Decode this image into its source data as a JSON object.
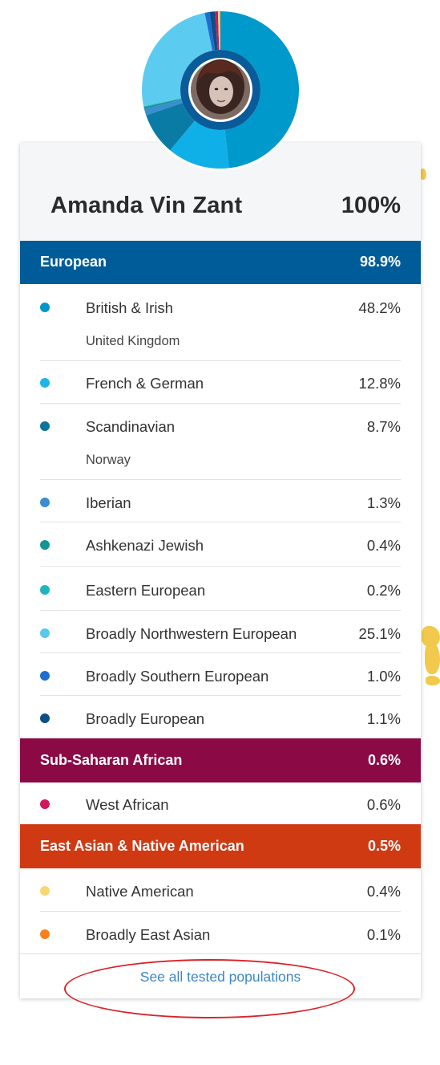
{
  "profile": {
    "name": "Amanda Vin Zant",
    "total": "100%"
  },
  "groups": [
    {
      "name": "European",
      "pct": "98.9%",
      "color": "#005c99"
    },
    {
      "name": "Sub-Saharan African",
      "pct": "0.6%",
      "color": "#8b0a45"
    },
    {
      "name": "East Asian & Native American",
      "pct": "0.5%",
      "color": "#d03a13"
    }
  ],
  "rows": [
    {
      "name": "British & Irish",
      "pct": "48.2%",
      "sub": "United Kingdom",
      "color": "#0095cc"
    },
    {
      "name": "French & German",
      "pct": "12.8%",
      "color": "#1db4ea"
    },
    {
      "name": "Scandinavian",
      "pct": "8.7%",
      "sub": "Norway",
      "color": "#0b749e"
    },
    {
      "name": "Iberian",
      "pct": "1.3%",
      "color": "#3b8dd1"
    },
    {
      "name": "Ashkenazi Jewish",
      "pct": "0.4%",
      "color": "#129594"
    },
    {
      "name": "Eastern European",
      "pct": "0.2%",
      "color": "#1cb6bd"
    },
    {
      "name": "Broadly Northwestern European",
      "pct": "25.1%",
      "color": "#58c8ec"
    },
    {
      "name": "Broadly Southern European",
      "pct": "1.0%",
      "color": "#1e6ecf"
    },
    {
      "name": "Broadly European",
      "pct": "1.1%",
      "color": "#0a4f86"
    },
    {
      "name": "West African",
      "pct": "0.6%",
      "color": "#d1175e"
    },
    {
      "name": "Native American",
      "pct": "0.4%",
      "color": "#f7d774"
    },
    {
      "name": "Broadly East Asian",
      "pct": "0.1%",
      "color": "#f58220"
    }
  ],
  "donut": {
    "segments": [
      {
        "label": "British & Irish",
        "value": 48.2,
        "color": "#0099cc"
      },
      {
        "label": "French & German",
        "value": 12.8,
        "color": "#0fb0e8"
      },
      {
        "label": "Scandinavian",
        "value": 8.7,
        "color": "#0a7ba5"
      },
      {
        "label": "Iberian",
        "value": 1.3,
        "color": "#3b8dd1"
      },
      {
        "label": "Ashkenazi Jewish",
        "value": 0.4,
        "color": "#129594"
      },
      {
        "label": "Eastern European",
        "value": 0.2,
        "color": "#1cb6bd"
      },
      {
        "label": "Broadly Northwestern European",
        "value": 25.1,
        "color": "#5ccbf0"
      },
      {
        "label": "Broadly Southern European",
        "value": 1.0,
        "color": "#1e6ecf"
      },
      {
        "label": "Broadly European",
        "value": 1.1,
        "color": "#0a4f86"
      },
      {
        "label": "West African",
        "value": 0.6,
        "color": "#d1175e"
      },
      {
        "label": "Native American",
        "value": 0.4,
        "color": "#f7d774"
      },
      {
        "label": "Broadly East Asian",
        "value": 0.1,
        "color": "#f58220"
      }
    ],
    "ring_color": "#0a5b9a"
  },
  "footer": {
    "see_all": "See all tested populations"
  },
  "annotation_color": "#d8232a"
}
